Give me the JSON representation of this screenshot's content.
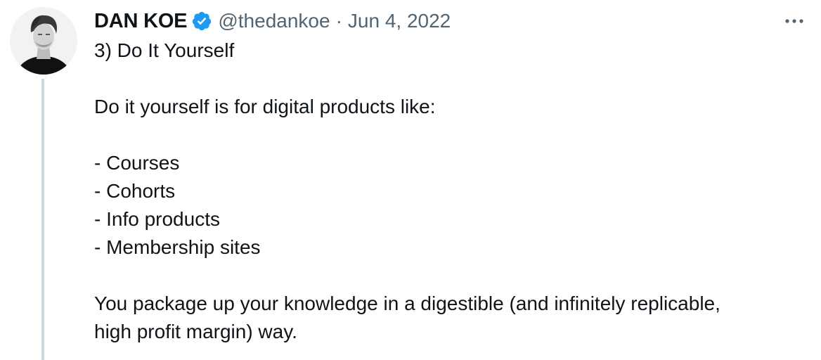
{
  "author": {
    "display_name": "DAN KOE",
    "handle": "@thedankoe",
    "separator": "·",
    "date": "Jun 4, 2022",
    "verified": true
  },
  "icons": {
    "verified": "verified-badge-icon",
    "more": "more-horizontal-icon",
    "avatar": "profile-photo"
  },
  "colors": {
    "text": "#0f1419",
    "secondary": "#536471",
    "verified_blue": "#1d9bf0",
    "thread_line": "#cfd9de"
  },
  "tweet": {
    "title": "3) Do It Yourself",
    "intro": "Do it yourself is for digital products like:",
    "list": [
      "- Courses",
      "- Cohorts",
      "- Info products",
      "- Membership sites"
    ],
    "outro_line1": "You package up your knowledge in a digestible (and infinitely replicable,",
    "outro_line2": "high profit margin) way."
  }
}
